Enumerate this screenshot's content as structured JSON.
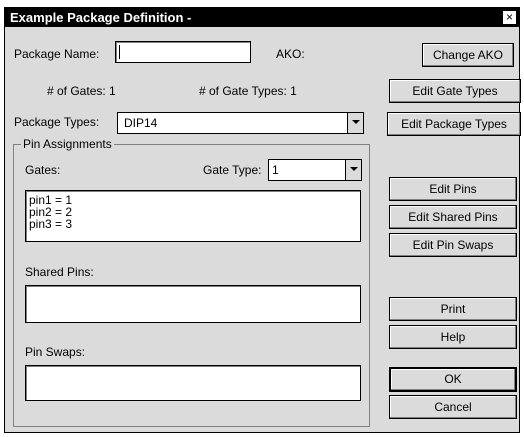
{
  "window": {
    "title": "Example Package Definition -",
    "close_glyph": "×"
  },
  "package_name": {
    "label": "Package Name:",
    "value": ""
  },
  "ako_label": "AKO:",
  "gates_count": "# of Gates: 1",
  "gate_types_count": "# of Gate Types: 1",
  "package_types": {
    "label": "Package Types:",
    "selected": "DIP14"
  },
  "pin_assignments": {
    "title": "Pin Assignments",
    "gates_label": "Gates:",
    "gate_type": {
      "label": "Gate Type:",
      "selected": "1"
    },
    "gates_list": [
      "pin1 = 1",
      "pin2 = 2",
      "pin3 = 3"
    ],
    "shared_pins_label": "Shared Pins:",
    "shared_pins_list": [],
    "pin_swaps_label": "Pin Swaps:",
    "pin_swaps_list": []
  },
  "buttons": {
    "change_ako": "Change AKO",
    "edit_gate_types": "Edit Gate Types",
    "edit_package_types": "Edit Package Types",
    "edit_pins": "Edit Pins",
    "edit_shared_pins": "Edit Shared Pins",
    "edit_pin_swaps": "Edit Pin Swaps",
    "print": "Print",
    "help": "Help",
    "ok": "OK",
    "cancel": "Cancel"
  }
}
